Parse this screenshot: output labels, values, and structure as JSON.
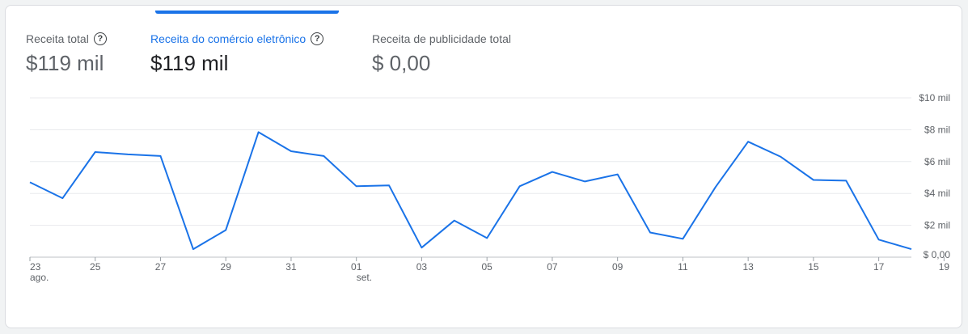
{
  "metrics": [
    {
      "label": "Receita total",
      "value": "$119 mil",
      "help_icon": "help-circle-icon"
    },
    {
      "label": "Receita do comércio eletrônico",
      "value": "$119 mil",
      "help_icon": "help-circle-icon",
      "selected": true
    },
    {
      "label": "Receita de publicidade total",
      "value": "$ 0,00"
    }
  ],
  "colors": {
    "accent": "#1a73e8",
    "line": "#1a73e8",
    "grid": "#e8eaed"
  },
  "chart_data": {
    "type": "line",
    "x": [
      "23 ago.",
      "24",
      "25",
      "26",
      "27",
      "28",
      "29",
      "30",
      "31",
      "01 set.",
      "02",
      "03",
      "04",
      "05",
      "06",
      "07",
      "08",
      "09",
      "10",
      "11",
      "12",
      "13",
      "14",
      "15",
      "16",
      "17",
      "18",
      "19"
    ],
    "x_tick_labels": [
      {
        "day": "23",
        "month": "ago."
      },
      {
        "day": "25"
      },
      {
        "day": "27"
      },
      {
        "day": "29"
      },
      {
        "day": "31"
      },
      {
        "day": "01",
        "month": "set."
      },
      {
        "day": "03"
      },
      {
        "day": "05"
      },
      {
        "day": "07"
      },
      {
        "day": "09"
      },
      {
        "day": "11"
      },
      {
        "day": "13"
      },
      {
        "day": "15"
      },
      {
        "day": "17"
      },
      {
        "day": "19"
      }
    ],
    "y_tick_labels": [
      "$ 0,00",
      "$2 mil",
      "$4 mil",
      "$6 mil",
      "$8 mil",
      "$10 mil"
    ],
    "ylim": [
      0,
      10000
    ],
    "series": [
      {
        "values": [
          4700,
          3700,
          6600,
          6450,
          6350,
          500,
          1700,
          7850,
          6650,
          6350,
          4450,
          4500,
          600,
          2300,
          1200,
          4450,
          5350,
          4750,
          5200,
          1550,
          1150,
          4400,
          7250,
          6300,
          4850,
          4800,
          1100,
          500
        ]
      }
    ],
    "grid": true,
    "legend": "none"
  }
}
